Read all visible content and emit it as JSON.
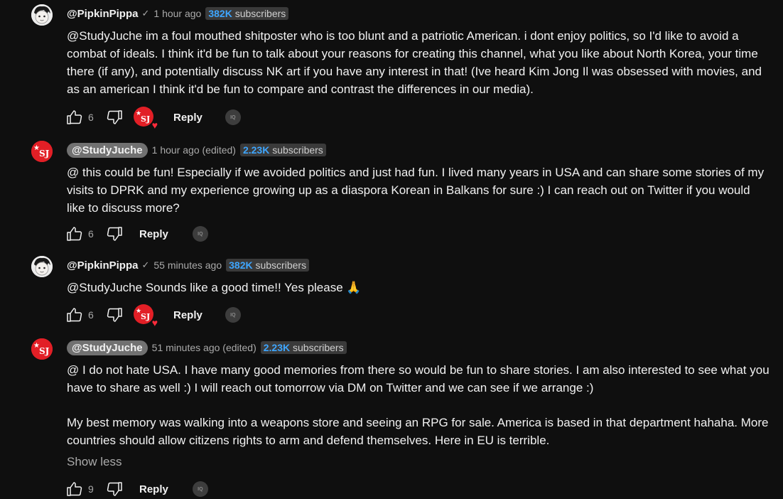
{
  "comments": [
    {
      "author": "@PipkinPippa",
      "verified": true,
      "time": "1 hour ago",
      "subscribers_num": "382K",
      "subscribers_label": "subscribers",
      "text": [
        "@StudyJuche  im a foul mouthed shitposter who is too blunt and a patriotic American. i dont enjoy politics, so I'd like to avoid a combat of ideals. I think it'd be fun to talk about your reasons for creating this channel, what you like about North Korea, your time there (if any), and potentially discuss NK art if you have any interest in that! (Ive heard Kim Jong Il was obsessed with movies, and as an american I think it'd be fun to compare and contrast the differences in our media)."
      ],
      "likes": "6",
      "creator_hearted": true,
      "reply_label": "Reply"
    },
    {
      "author": "@StudyJuche",
      "verified": false,
      "time": "1 hour ago (edited)",
      "subscribers_num": "2.23K",
      "subscribers_label": "subscribers",
      "text": [
        "@ this could be fun! Especially if we avoided politics and just had fun. I lived many years in USA and can share some stories of my visits to DPRK and my experience growing up as a diaspora Korean in Balkans for sure :) I can reach out on Twitter if you would like to discuss more?"
      ],
      "likes": "6",
      "creator_hearted": false,
      "reply_label": "Reply"
    },
    {
      "author": "@PipkinPippa",
      "verified": true,
      "time": "55 minutes ago",
      "subscribers_num": "382K",
      "subscribers_label": "subscribers",
      "text": [
        "@StudyJuche Sounds like a good time!! Yes please 🙏"
      ],
      "likes": "6",
      "creator_hearted": true,
      "reply_label": "Reply"
    },
    {
      "author": "@StudyJuche",
      "verified": false,
      "time": "51 minutes ago (edited)",
      "subscribers_num": "2.23K",
      "subscribers_label": "subscribers",
      "text": [
        "@ I do not hate USA. I have many good memories from there so would be fun to share stories. I am also interested to see what you have to share as well :) I will reach out tomorrow via DM on Twitter and we can see if we arrange :)",
        "My best memory was walking into a weapons store and seeing an RPG for sale. America is based in that department hahaha. More countries should allow citizens rights to arm and defend themselves. Here in EU is terrible."
      ],
      "show_less": "Show less",
      "likes": "9",
      "creator_hearted": false,
      "reply_label": "Reply"
    }
  ],
  "channel_avatar_text": "SJ",
  "iq_label": "IQ",
  "colors": {
    "background": "#0f0f0f",
    "subscriber_count": "#3ea6ff",
    "channel_red": "#e21f26",
    "heart": "#ff2b3b"
  }
}
